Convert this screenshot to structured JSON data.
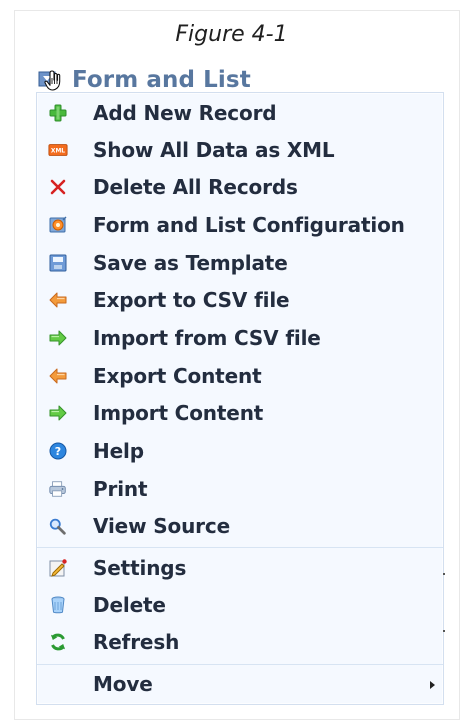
{
  "figure": {
    "caption": "Figure 4-1"
  },
  "module": {
    "title": "Form and List"
  },
  "menu": {
    "groups": [
      {
        "items": [
          {
            "label": "Add New Record",
            "icon": "add-icon"
          },
          {
            "label": "Show All Data as XML",
            "icon": "xml-icon"
          },
          {
            "label": "Delete All Records",
            "icon": "delete-x-icon"
          },
          {
            "label": "Form and List Configuration",
            "icon": "configuration-icon"
          },
          {
            "label": "Save as Template",
            "icon": "save-template-icon"
          },
          {
            "label": "Export to CSV file",
            "icon": "export-arrow-icon"
          },
          {
            "label": "Import from CSV file",
            "icon": "import-arrow-icon"
          },
          {
            "label": "Export Content",
            "icon": "export-arrow-icon"
          },
          {
            "label": "Import Content",
            "icon": "import-arrow-icon"
          },
          {
            "label": "Help",
            "icon": "help-icon"
          },
          {
            "label": "Print",
            "icon": "print-icon"
          },
          {
            "label": "View Source",
            "icon": "view-source-icon"
          }
        ]
      },
      {
        "items": [
          {
            "label": "Settings",
            "icon": "settings-icon"
          },
          {
            "label": "Delete",
            "icon": "trash-icon"
          },
          {
            "label": "Refresh",
            "icon": "refresh-icon"
          }
        ]
      },
      {
        "items": [
          {
            "label": "Move",
            "icon": ""
          }
        ]
      }
    ]
  },
  "colors": {
    "menu_bg": "#f5f9ff",
    "menu_border": "#d3dfef",
    "separator": "#d7e4f3",
    "header_text": "#58779f",
    "item_text": "#232d3f"
  }
}
